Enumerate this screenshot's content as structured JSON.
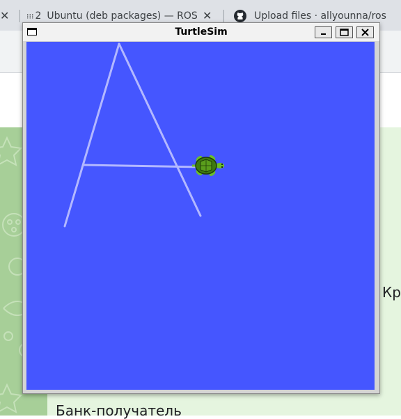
{
  "browser": {
    "tabs": [
      {
        "label": "Ubuntu (deb packages) — ROS 2"
      },
      {
        "label": "Upload files · allyounna/ros"
      }
    ],
    "tab_group_label": "2"
  },
  "page": {
    "text_right": "Кр",
    "text_bottom": "Банк-получатель"
  },
  "turtlesim": {
    "title": "TurtleSim",
    "background_color": "#4556ff",
    "pen_color": "#b3b8ff",
    "drawing_label": "A"
  },
  "colors": {
    "tab_bar": "#dee1e6",
    "page_green": "#e5f5df",
    "turtle_shell": "#3e7a10"
  }
}
